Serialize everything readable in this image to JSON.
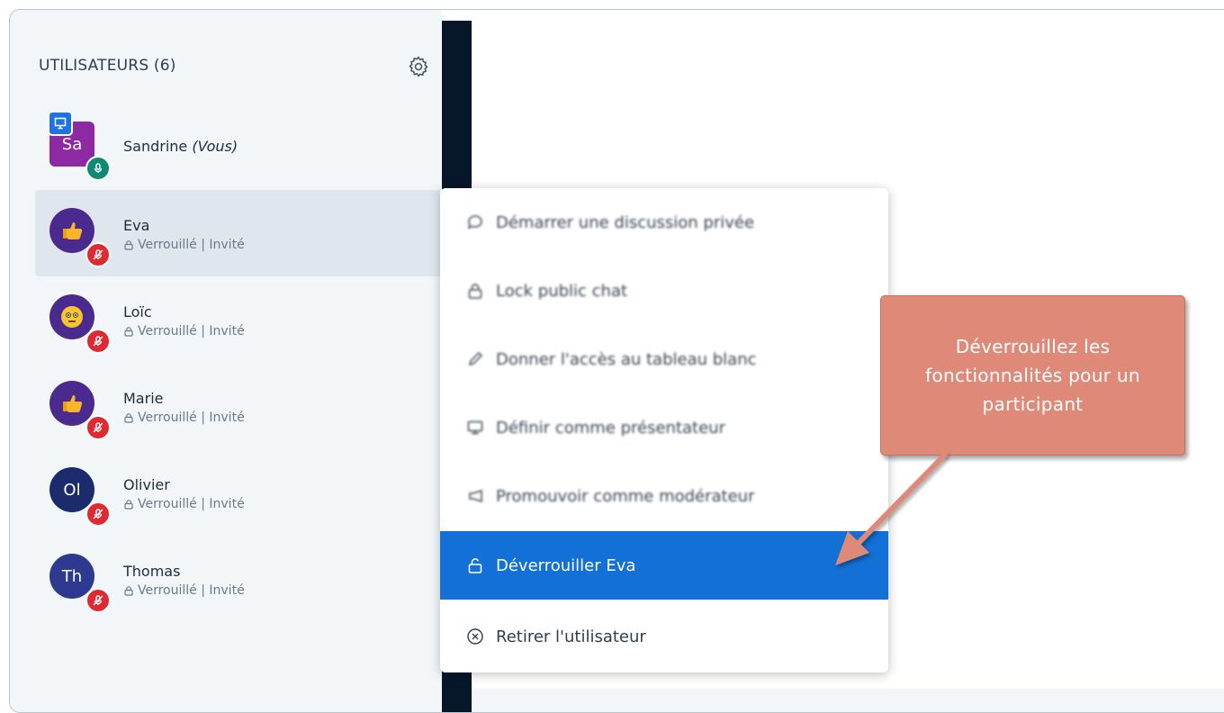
{
  "sidebar": {
    "title": "UTILISATEURS (6)",
    "users": [
      {
        "initials": "Sa",
        "name": "Sandrine",
        "suffix": "(Vous)",
        "status": ""
      },
      {
        "initials": "",
        "name": "Eva",
        "suffix": "",
        "status": "Verrouillé | Invité"
      },
      {
        "initials": "",
        "name": "Loïc",
        "suffix": "",
        "status": "Verrouillé | Invité"
      },
      {
        "initials": "",
        "name": "Marie",
        "suffix": "",
        "status": "Verrouillé | Invité"
      },
      {
        "initials": "Ol",
        "name": "Olivier",
        "suffix": "",
        "status": "Verrouillé | Invité"
      },
      {
        "initials": "Th",
        "name": "Thomas",
        "suffix": "",
        "status": "Verrouillé | Invité"
      }
    ]
  },
  "menu": {
    "items": [
      {
        "label": "Démarrer une discussion privée",
        "icon": "chat-bubble-icon"
      },
      {
        "label": "Lock public chat",
        "icon": "lock-icon"
      },
      {
        "label": "Donner l'accès au tableau blanc",
        "icon": "pencil-icon"
      },
      {
        "label": "Définir comme présentateur",
        "icon": "presentation-icon"
      },
      {
        "label": "Promouvoir comme modérateur",
        "icon": "megaphone-icon"
      },
      {
        "label": "Déverrouiller Eva",
        "icon": "unlock-icon"
      },
      {
        "label": "Retirer l'utilisateur",
        "icon": "close-circle-icon"
      }
    ]
  },
  "callout": {
    "text": "Déverrouillez les fonctionnalités pour un participant"
  },
  "colors": {
    "accent": "#1270d6",
    "callout": "#df8a78",
    "sandrine_avatar": "#8e29a4",
    "thumbs_avatar": "#4a2a8c",
    "olivier_avatar": "#1c2b6b",
    "thomas_avatar": "#2d3a8f",
    "muted_red": "#df2a32",
    "mic_green": "#0e8a74"
  }
}
